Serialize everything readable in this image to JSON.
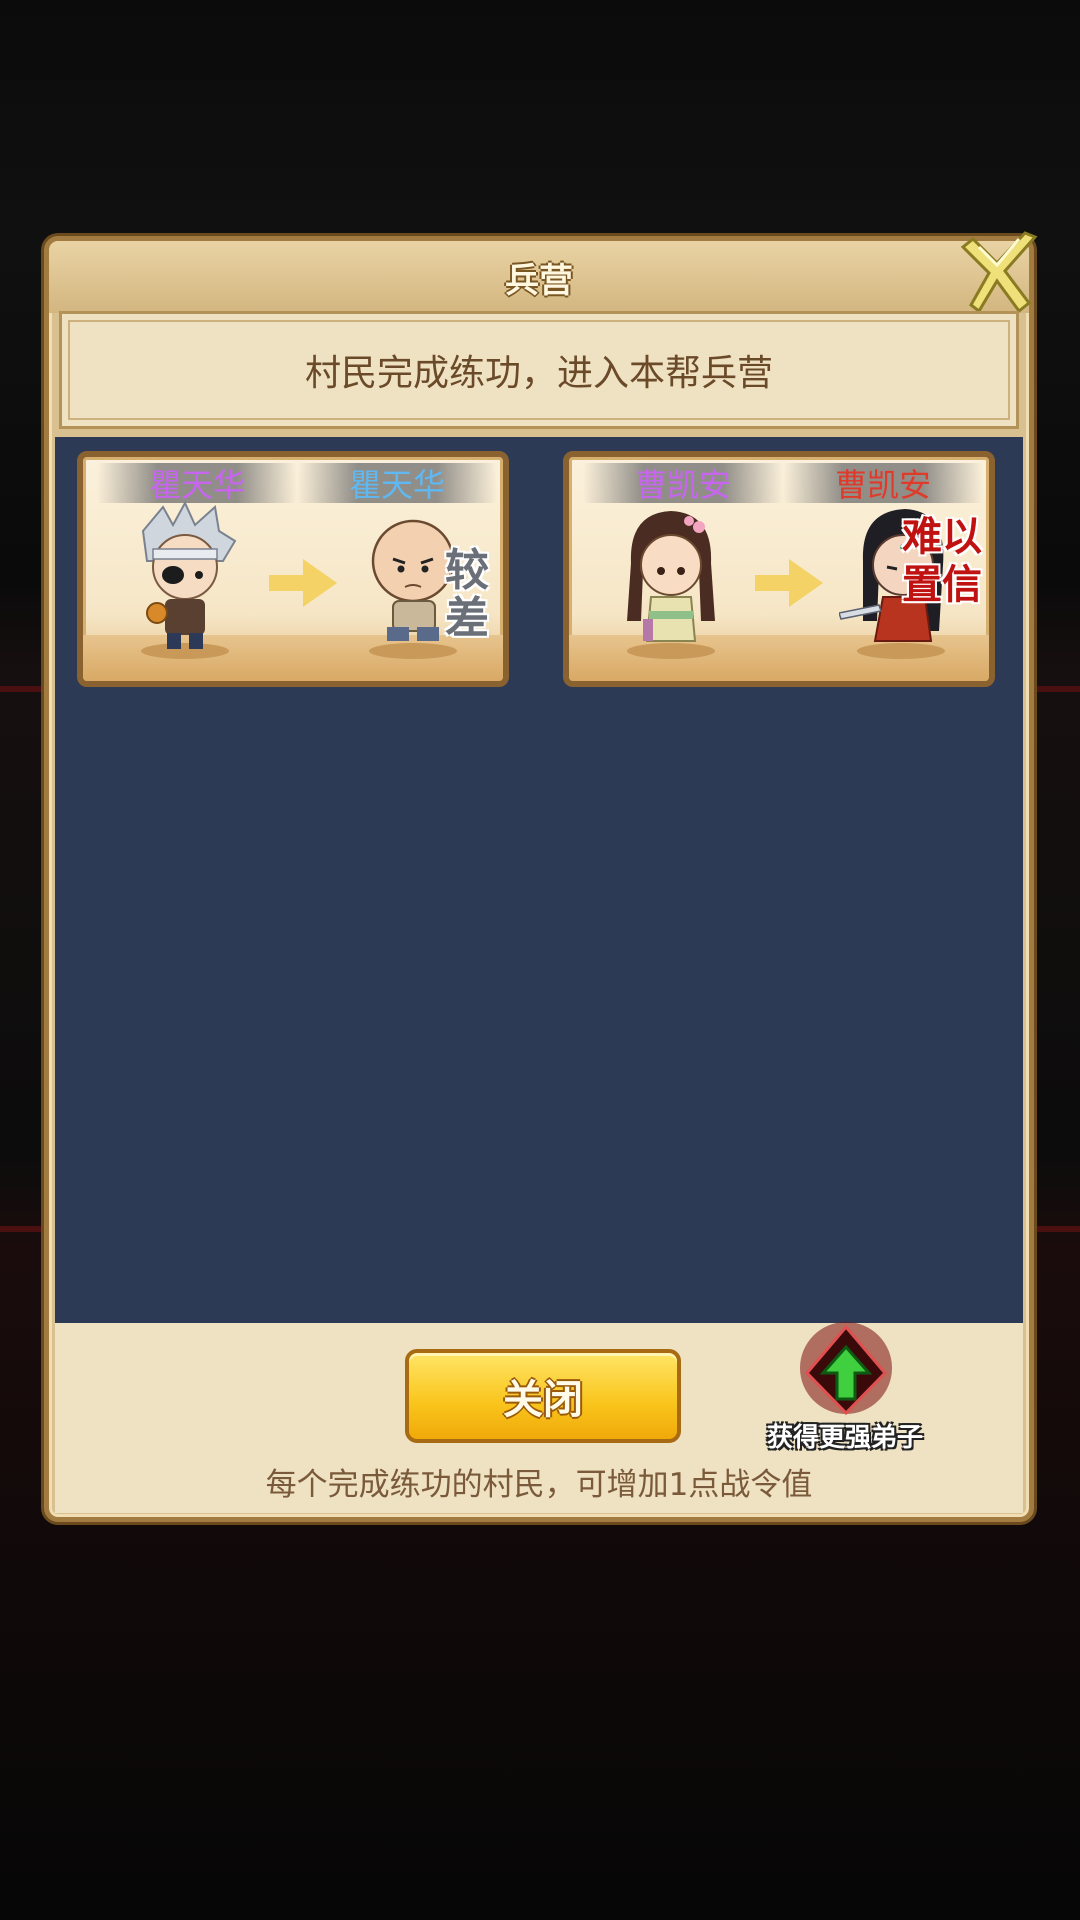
{
  "dialog": {
    "title": "兵营",
    "banner": "村民完成练功，进入本帮兵营",
    "close_button": "关闭",
    "upgrade_label": "获得更强弟子",
    "footer_note": "每个完成练功的村民，可增加1点战令值"
  },
  "recruits": [
    {
      "from_name": "瞿天华",
      "from_name_color": "#c865f0",
      "to_name": "瞿天华",
      "to_name_color": "#5fb8f2",
      "rating": "较差",
      "rating_color": "#6b6f77"
    },
    {
      "from_name": "曹凯安",
      "from_name_color": "#c865f0",
      "to_name": "曹凯安",
      "to_name_color": "#e03a2a",
      "rating": "难以置信",
      "rating_color": "#c11212"
    }
  ]
}
